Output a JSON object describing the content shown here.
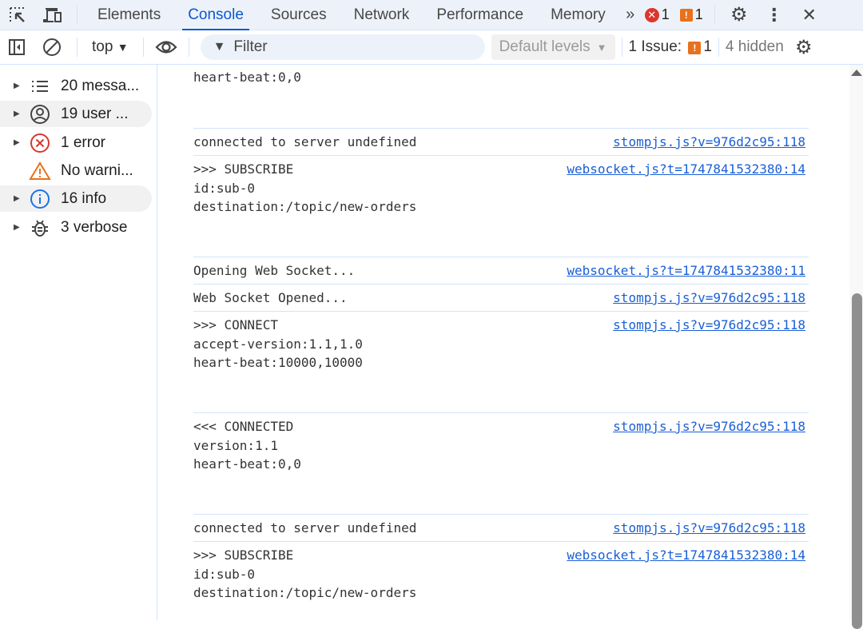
{
  "tabs": [
    "Elements",
    "Console",
    "Sources",
    "Network",
    "Performance",
    "Memory"
  ],
  "active_tab": "Console",
  "error_count": "1",
  "issue_count": "1",
  "toolbar": {
    "context": "top",
    "filter_placeholder": "Filter",
    "levels": "Default levels",
    "issues_label": "1 Issue:",
    "issues_count": "1",
    "hidden": "4 hidden"
  },
  "sidebar": [
    {
      "label": "20 messa...",
      "icon": "list-icon"
    },
    {
      "label": "19 user ...",
      "icon": "user-icon"
    },
    {
      "label": "1 error",
      "icon": "error-icon"
    },
    {
      "label": "No warni...",
      "icon": "warning-icon"
    },
    {
      "label": "16 info",
      "icon": "info-icon"
    },
    {
      "label": "3 verbose",
      "icon": "bug-icon"
    }
  ],
  "messages": [
    {
      "text": "heart-beat:0,0",
      "source": ""
    },
    {
      "text": "connected to server undefined",
      "source": "stompjs.js?v=976d2c95:118"
    },
    {
      "text": ">>> SUBSCRIBE\nid:sub-0\ndestination:/topic/new-orders",
      "source": "websocket.js?t=1747841532380:14"
    },
    {
      "text": "Opening Web Socket...",
      "source": "websocket.js?t=1747841532380:11"
    },
    {
      "text": "Web Socket Opened...",
      "source": "stompjs.js?v=976d2c95:118"
    },
    {
      "text": ">>> CONNECT\naccept-version:1.1,1.0\nheart-beat:10000,10000",
      "source": "stompjs.js?v=976d2c95:118"
    },
    {
      "text": "<<< CONNECTED\nversion:1.1\nheart-beat:0,0",
      "source": "stompjs.js?v=976d2c95:118"
    },
    {
      "text": "connected to server undefined",
      "source": "stompjs.js?v=976d2c95:118"
    },
    {
      "text": ">>> SUBSCRIBE\nid:sub-0\ndestination:/topic/new-orders",
      "source": "websocket.js?t=1747841532380:14"
    }
  ]
}
